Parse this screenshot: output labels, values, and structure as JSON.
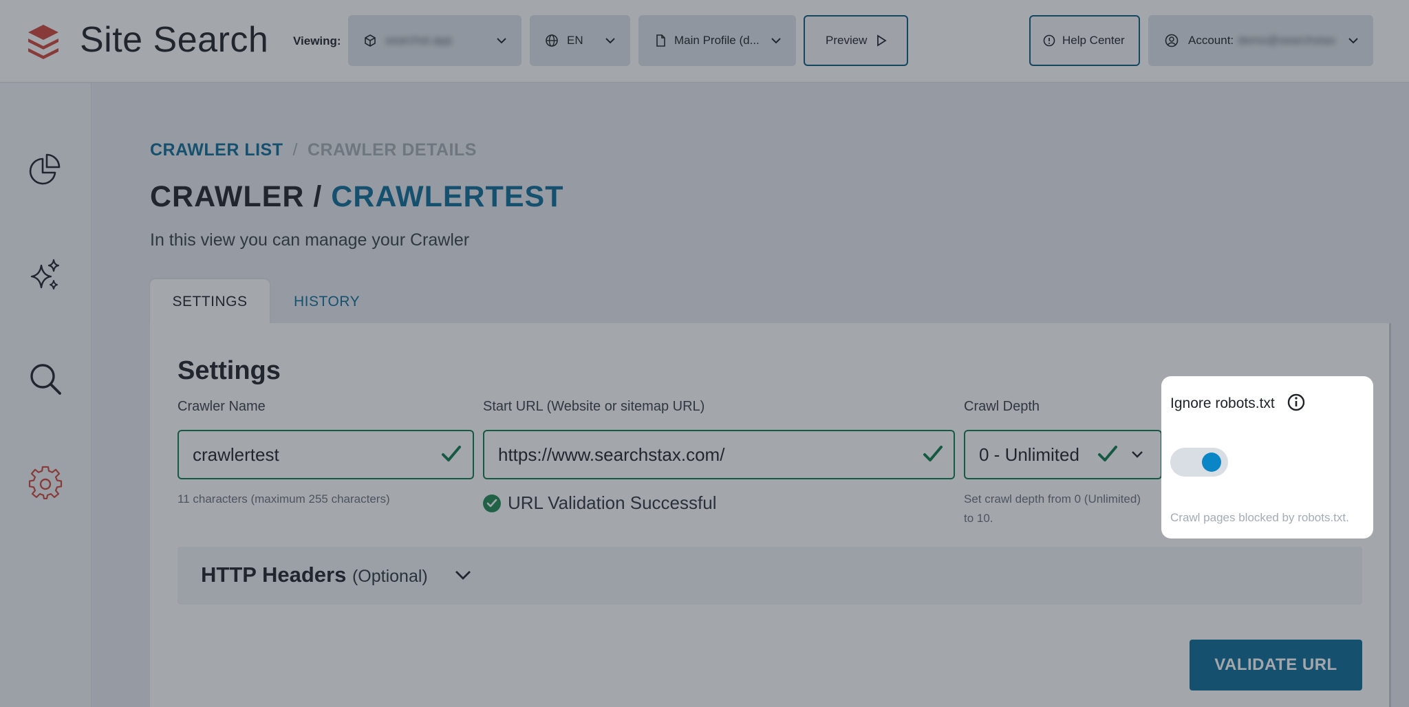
{
  "header": {
    "app_title": "Site Search",
    "viewing_label": "Viewing:",
    "app_selector": {
      "value": "searchst.app"
    },
    "language_selector": {
      "value": "EN"
    },
    "profile_selector": {
      "value": "Main Profile (d..."
    },
    "preview_label": "Preview",
    "help_label": "Help Center",
    "account_label": "Account:",
    "account_value": "demo@searchstax"
  },
  "sidebar": {
    "items": [
      {
        "name": "analytics",
        "icon": "pie-chart-icon",
        "active": false
      },
      {
        "name": "ai",
        "icon": "sparkles-icon",
        "active": false
      },
      {
        "name": "search",
        "icon": "search-icon",
        "active": false
      },
      {
        "name": "settings",
        "icon": "gear-icon",
        "active": true
      }
    ]
  },
  "breadcrumb": {
    "link": "CRAWLER LIST",
    "separator": "/",
    "current": "CRAWLER DETAILS"
  },
  "page": {
    "title_prefix": "CRAWLER /",
    "title_name": "CRAWLERTEST",
    "subtitle": "In this view you can manage your Crawler"
  },
  "tabs": [
    {
      "label": "SETTINGS",
      "active": true
    },
    {
      "label": "HISTORY",
      "active": false
    }
  ],
  "settings": {
    "heading": "Settings",
    "crawler_name": {
      "label": "Crawler Name",
      "value": "crawlertest",
      "hint": "11 characters (maximum 255 characters)"
    },
    "start_url": {
      "label": "Start URL (Website or sitemap URL)",
      "value": "https://www.searchstax.com/",
      "validation": "URL Validation Successful"
    },
    "crawl_depth": {
      "label": "Crawl Depth",
      "value": "0 - Unlimited",
      "hint_line1": "Set crawl depth from 0 (Unlimited)",
      "hint_line2": "to 10."
    },
    "http_headers": {
      "title": "HTTP Headers",
      "optional": "(Optional)"
    },
    "validate_button": "VALIDATE URL"
  },
  "robots_popover": {
    "label": "Ignore robots.txt",
    "toggle_on": true,
    "hint": "Crawl pages blocked by robots.txt."
  },
  "colors": {
    "accent": "#0b6d97",
    "success": "#0d7a4a",
    "danger_icon": "#d0453a",
    "toggle_knob": "#0a86c6"
  }
}
